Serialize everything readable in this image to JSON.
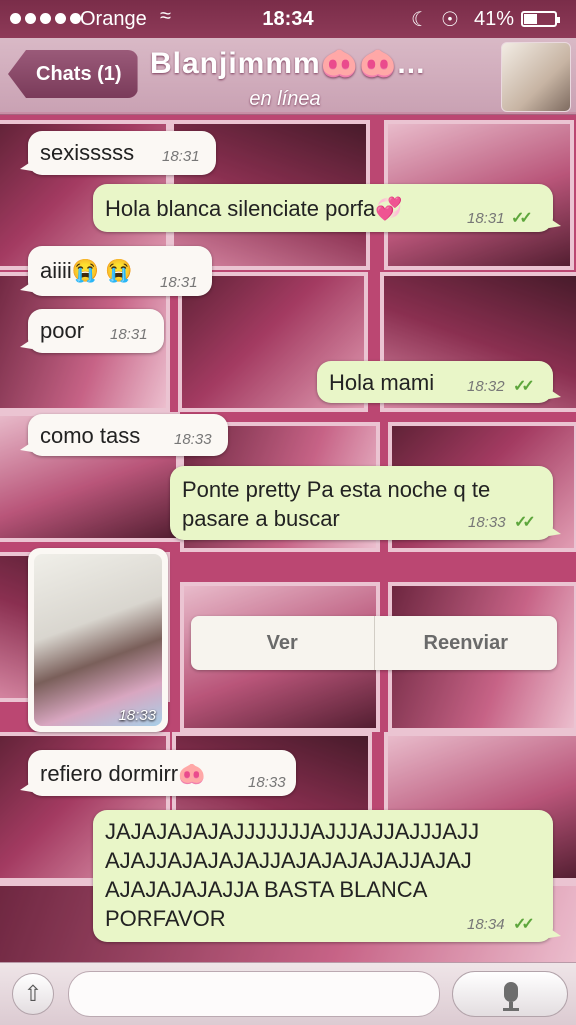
{
  "status_bar": {
    "carrier": "Orange",
    "time": "18:34",
    "battery": "41%",
    "battery_level": 0.41,
    "wifi_icon": "wifi-icon",
    "moon_icon": "do-not-disturb-icon",
    "lock_icon": "rotation-lock-icon"
  },
  "nav": {
    "back_label": "Chats (1)",
    "contact_name": "Blanjimmm🐽🐽...",
    "contact_status": "en línea"
  },
  "messages": [
    {
      "dir": "in",
      "text": "sexisssss",
      "time": "18:31"
    },
    {
      "dir": "out",
      "text": "Hola blanca silenciate porfa💞",
      "time": "18:31"
    },
    {
      "dir": "in",
      "text": "aiiii😭 😭",
      "time": "18:31"
    },
    {
      "dir": "in",
      "text": "poor",
      "time": "18:31"
    },
    {
      "dir": "out",
      "text": "Hola mami",
      "time": "18:32"
    },
    {
      "dir": "in",
      "text": "como tass",
      "time": "18:33"
    },
    {
      "dir": "out",
      "text": "Ponte pretty Pa esta noche q te pasare a buscar",
      "line1": "Ponte pretty Pa esta noche q te",
      "line2": "pasare a buscar",
      "time": "18:33"
    },
    {
      "dir": "in",
      "type": "image",
      "time": "18:33"
    },
    {
      "dir": "in",
      "text": "refiero dormirr🐽",
      "time": "18:33"
    },
    {
      "dir": "out",
      "text": "JAJAJAJAJAJJJJJJJAJJJAJJAJJJAJJAJAJJAJAJAJAJJAJAJAJAJAJJAJAJAJAJAJAJAJJA BASTA BLANCA PORFAVOR",
      "line1": "JAJAJAJAJAJJJJJJJAJJJAJJAJJJAJJ",
      "line2": "AJAJJAJAJAJAJJAJAJAJAJAJJAJAJ",
      "line3": "AJAJAJAJAJJA BASTA BLANCA",
      "line4": "PORFAVOR",
      "time": "18:34"
    }
  ],
  "media_actions": {
    "view": "Ver",
    "forward": "Reenviar"
  },
  "input_bar": {
    "share_icon": "share-icon",
    "mic_icon": "microphone-icon",
    "placeholder": ""
  },
  "colors": {
    "incoming_bubble": "#fbf8f4",
    "outgoing_bubble": "#e9f6c8",
    "read_ticks": "#5da63c",
    "nav_accent": "#7a3b5a"
  }
}
